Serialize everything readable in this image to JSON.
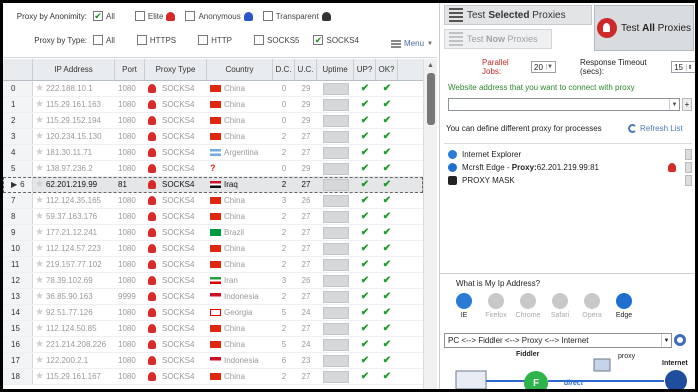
{
  "filters": {
    "anonymity_label": "Proxy by Anonimity:",
    "anonymity_options": [
      {
        "label": "All",
        "checked": true
      },
      {
        "label": "Elite",
        "checked": false
      },
      {
        "label": "Anonymous",
        "checked": false
      },
      {
        "label": "Transparent",
        "checked": false
      }
    ],
    "type_label": "Proxy by Type:",
    "type_options": [
      {
        "label": "All",
        "checked": false
      },
      {
        "label": "HTTPS",
        "checked": false
      },
      {
        "label": "HTTP",
        "checked": false
      },
      {
        "label": "SOCKS5",
        "checked": false
      },
      {
        "label": "SOCKS4",
        "checked": true
      }
    ],
    "menu_label": "Menu"
  },
  "grid": {
    "headers": [
      "IP Address",
      "Port",
      "Proxy Type",
      "Country",
      "D.C.",
      "U.C.",
      "Uptime",
      "UP?",
      "OK?"
    ],
    "rows": [
      {
        "idx": "0",
        "ip": "222.188.10.1",
        "port": "1080",
        "type": "SOCKS4",
        "country": "China",
        "flag": "cn",
        "dc": "0",
        "uc": "29"
      },
      {
        "idx": "1",
        "ip": "115.29.161.163",
        "port": "1080",
        "type": "SOCKS4",
        "country": "China",
        "flag": "cn",
        "dc": "0",
        "uc": "29"
      },
      {
        "idx": "2",
        "ip": "115.29.152.194",
        "port": "1080",
        "type": "SOCKS4",
        "country": "China",
        "flag": "cn",
        "dc": "0",
        "uc": "29"
      },
      {
        "idx": "3",
        "ip": "120.234.15.130",
        "port": "1080",
        "type": "SOCKS4",
        "country": "China",
        "flag": "cn",
        "dc": "2",
        "uc": "27"
      },
      {
        "idx": "4",
        "ip": "181.30.11.71",
        "port": "1080",
        "type": "SOCKS4",
        "country": "Argentina",
        "flag": "ar",
        "dc": "2",
        "uc": "27"
      },
      {
        "idx": "5",
        "ip": "138.97.236.2",
        "port": "1080",
        "type": "SOCKS4",
        "country": "",
        "flag": "unknown",
        "dc": "0",
        "uc": "29"
      },
      {
        "idx": "6",
        "ip": "62.201.219.99",
        "port": "81",
        "type": "SOCKS4",
        "country": "Iraq",
        "flag": "iq",
        "dc": "2",
        "uc": "27",
        "selected": true
      },
      {
        "idx": "7",
        "ip": "112.124.35.165",
        "port": "1080",
        "type": "SOCKS4",
        "country": "China",
        "flag": "cn",
        "dc": "3",
        "uc": "26"
      },
      {
        "idx": "8",
        "ip": "59.37.163.176",
        "port": "1080",
        "type": "SOCKS4",
        "country": "China",
        "flag": "cn",
        "dc": "2",
        "uc": "27"
      },
      {
        "idx": "9",
        "ip": "177.21.12.241",
        "port": "1080",
        "type": "SOCKS4",
        "country": "Brazil",
        "flag": "br",
        "dc": "2",
        "uc": "27"
      },
      {
        "idx": "10",
        "ip": "112.124.57.223",
        "port": "1080",
        "type": "SOCKS4",
        "country": "China",
        "flag": "cn",
        "dc": "2",
        "uc": "27"
      },
      {
        "idx": "11",
        "ip": "219.157.77.102",
        "port": "1080",
        "type": "SOCKS4",
        "country": "China",
        "flag": "cn",
        "dc": "2",
        "uc": "27"
      },
      {
        "idx": "12",
        "ip": "78.39.102.69",
        "port": "1080",
        "type": "SOCKS4",
        "country": "Iran",
        "flag": "ir",
        "dc": "3",
        "uc": "26"
      },
      {
        "idx": "13",
        "ip": "36.85.90.163",
        "port": "9999",
        "type": "SOCKS4",
        "country": "Indonesia",
        "flag": "id",
        "dc": "2",
        "uc": "27"
      },
      {
        "idx": "14",
        "ip": "92.51.77.126",
        "port": "1080",
        "type": "SOCKS4",
        "country": "Georgia",
        "flag": "ge",
        "dc": "5",
        "uc": "24"
      },
      {
        "idx": "15",
        "ip": "112.124.50.85",
        "port": "1080",
        "type": "SOCKS4",
        "country": "China",
        "flag": "cn",
        "dc": "2",
        "uc": "27"
      },
      {
        "idx": "16",
        "ip": "221.214.208.226",
        "port": "1080",
        "type": "SOCKS4",
        "country": "China",
        "flag": "cn",
        "dc": "5",
        "uc": "24"
      },
      {
        "idx": "17",
        "ip": "122.200.2.1",
        "port": "1080",
        "type": "SOCKS4",
        "country": "Indonesia",
        "flag": "id",
        "dc": "6",
        "uc": "23"
      },
      {
        "idx": "18",
        "ip": "115.29.161.167",
        "port": "1080",
        "type": "SOCKS4",
        "country": "China",
        "flag": "cn",
        "dc": "2",
        "uc": "27"
      }
    ]
  },
  "right": {
    "test_selected": {
      "pre": "Test ",
      "bold": "Selected",
      "post": " Proxies"
    },
    "test_now": {
      "pre": "Test ",
      "bold": "Now",
      "post": " Proxies"
    },
    "test_all": {
      "pre": "Test ",
      "bold": "All",
      "post": " Proxies"
    },
    "parallel_label": "Parallel Jobs:",
    "parallel_value": "20",
    "timeout_label": "Response Timeout (secs):",
    "timeout_value": "15",
    "website_label": "Website address that you want to connect with proxy",
    "website_value": "",
    "define_label": "You can define different proxy for processes",
    "refresh_label": "Refresh List",
    "processes": [
      {
        "name": "Internet Explorer",
        "proxy": ""
      },
      {
        "name": "Mcrsft Edge - ",
        "proxy_label": "Proxy:",
        "proxy": "62.201.219.99:81"
      },
      {
        "name": "PROXY MASK",
        "proxy": ""
      }
    ],
    "ip_question": "What is My Ip Address?",
    "browsers": [
      {
        "name": "IE",
        "active": true
      },
      {
        "name": "Firefox",
        "active": false
      },
      {
        "name": "Chrome",
        "active": false
      },
      {
        "name": "Safari",
        "active": false
      },
      {
        "name": "Opera",
        "active": false
      },
      {
        "name": "Edge",
        "active": true
      }
    ],
    "pipeline": "PC <--> Fiddler <--> Proxy <--> Internet",
    "diagram": {
      "fiddler": "Fiddler",
      "proxy": "proxy",
      "internet": "Internet",
      "direct": "direct"
    }
  },
  "colors": {
    "accent_red": "#c62828",
    "check_green": "#1c9a2a",
    "link_blue": "#4a78b8"
  }
}
